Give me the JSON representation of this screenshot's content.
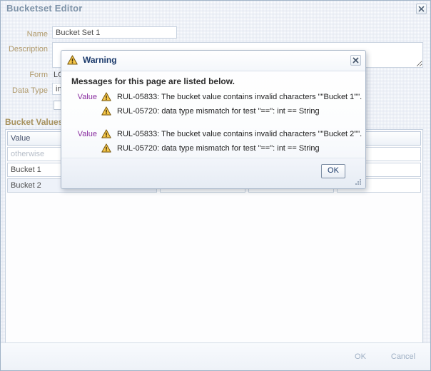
{
  "window": {
    "title": "Bucketset Editor",
    "close_icon": "close-icon"
  },
  "form": {
    "name_label": "Name",
    "name_value": "Bucket Set 1",
    "description_label": "Description",
    "description_value": "",
    "form_label": "Form",
    "form_value": "LO",
    "data_type_label": "Data Type",
    "data_type_value": "in"
  },
  "bucket_values": {
    "section_title": "Bucket Values",
    "columns": [
      "Value",
      "",
      "",
      ""
    ],
    "rows": [
      {
        "value": "otherwise",
        "muted": true,
        "selected": false
      },
      {
        "value": "Bucket 1",
        "muted": false,
        "selected": false
      },
      {
        "value": "Bucket 2",
        "muted": false,
        "selected": true
      }
    ]
  },
  "footer": {
    "ok_label": "OK",
    "cancel_label": "Cancel"
  },
  "dialog": {
    "title": "Warning",
    "title_icon": "warning-triangle-icon",
    "close_icon": "close-icon",
    "heading": "Messages for this page are listed below.",
    "ok_label": "OK",
    "resize_grip_icon": "resize-grip-icon",
    "groups": [
      {
        "field_label": "Value",
        "messages": [
          "RUL-05833: The bucket value contains invalid characters \"\"Bucket 1\"\".",
          "RUL-05720: data type mismatch for test \"==\": int == String"
        ]
      },
      {
        "field_label": "Value",
        "messages": [
          "RUL-05833: The bucket value contains invalid characters \"\"Bucket 2\"\".",
          "RUL-05720: data type mismatch for test \"==\": int == String"
        ]
      }
    ]
  },
  "colors": {
    "label": "#b09a6b",
    "section_title": "#a8935f",
    "field_label": "#8a2fa0",
    "dialog_title": "#1b3a6b",
    "window_title": "#7e93a8",
    "warning_yellow": "#f5c242"
  }
}
